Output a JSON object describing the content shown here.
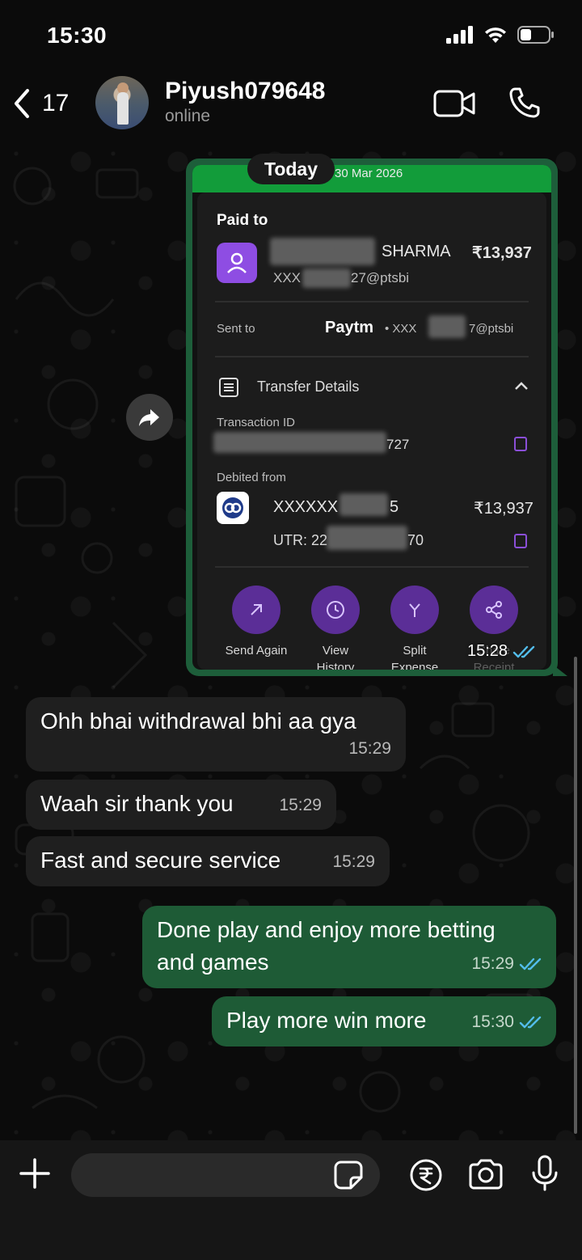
{
  "status_bar": {
    "time": "15:30"
  },
  "header": {
    "back_count": "17",
    "contact_name": "Piyush079648",
    "contact_status": "online"
  },
  "date_separator": "Today",
  "receipt": {
    "date_partial": "30 Mar 2026",
    "paid_to_label": "Paid to",
    "payee_name_partial": "SHARMA",
    "amount": "₹13,937",
    "payee_upi_prefix": "XXX",
    "payee_upi_suffix": "27@ptsbi",
    "sent_to_label": "Sent to",
    "sent_to_brand": "Paytm",
    "sent_to_prefix": "• XXX",
    "sent_to_suffix": "7@ptsbi",
    "transfer_details_label": "Transfer Details",
    "transaction_id_label": "Transaction ID",
    "transaction_id_suffix": "727",
    "debited_from_label": "Debited from",
    "account_prefix": "XXXXXX",
    "account_suffix": "5",
    "debited_amount": "₹13,937",
    "utr_prefix": "UTR: 22",
    "utr_suffix": "70",
    "actions": [
      {
        "label": "Send Again",
        "icon": "arrow-up-right-icon"
      },
      {
        "label": "View History",
        "icon": "clock-icon"
      },
      {
        "label": "Split Expense",
        "icon": "split-icon"
      },
      {
        "label": "Share Receipt",
        "icon": "share-icon"
      }
    ]
  },
  "image_message_time": "15:28",
  "messages": [
    {
      "direction": "in",
      "text": "Ohh bhai withdrawal bhi aa gya",
      "time": "15:29"
    },
    {
      "direction": "in",
      "text": "Waah sir thank you",
      "time": "15:29"
    },
    {
      "direction": "in",
      "text": "Fast and secure service",
      "time": "15:29"
    },
    {
      "direction": "out",
      "text_line1": "Done play and enjoy more betting",
      "text_line2": "and games",
      "time": "15:29"
    },
    {
      "direction": "out",
      "text": "Play more win more",
      "time": "15:30"
    }
  ],
  "composer": {
    "placeholder": ""
  },
  "colors": {
    "outgoing_bubble": "#1e5b36",
    "incoming_bubble": "#1f1f1f",
    "read_tick": "#53bdeb",
    "paytm_purple": "#5b2e97"
  }
}
